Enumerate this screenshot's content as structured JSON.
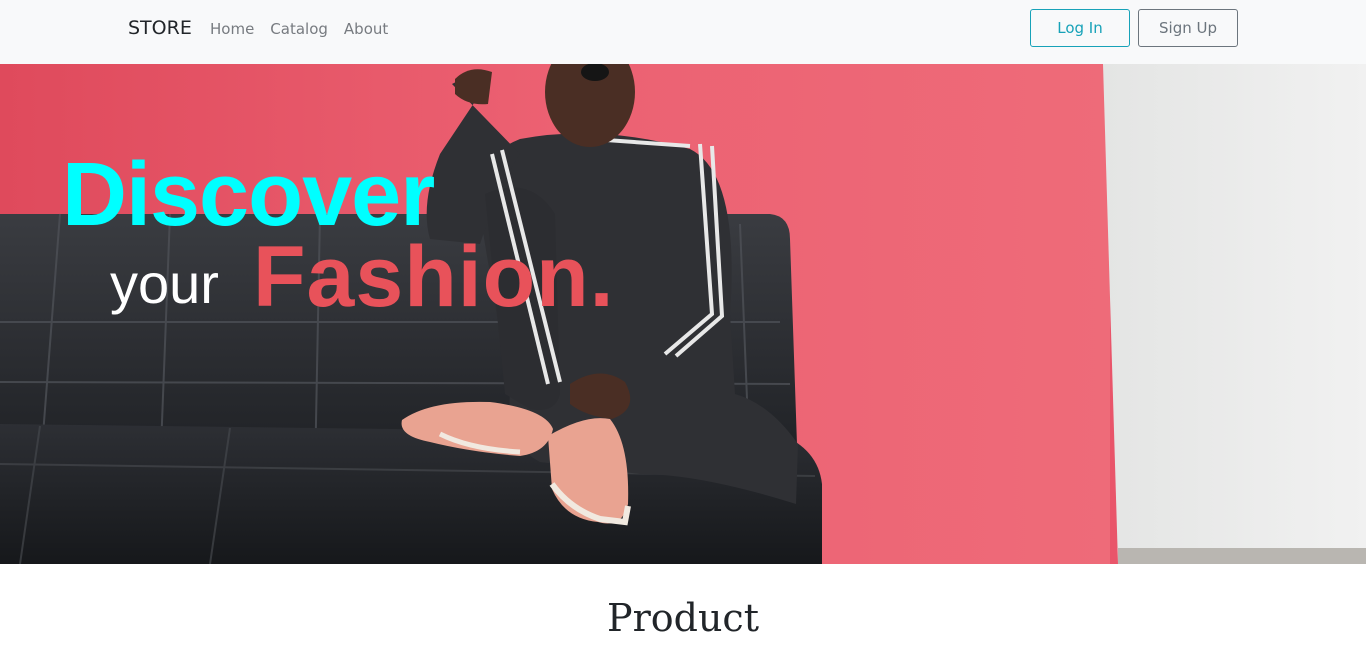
{
  "navbar": {
    "brand": "STORE",
    "links": [
      {
        "label": "Home"
      },
      {
        "label": "Catalog"
      },
      {
        "label": "About"
      }
    ],
    "login_label": "Log In",
    "signup_label": "Sign Up"
  },
  "hero": {
    "headline_1": "Discover",
    "headline_2": "your",
    "headline_3": "Fashion.",
    "image_semantic": "woman-on-black-sofa-photo"
  },
  "product": {
    "title": "Product"
  },
  "colors": {
    "cyan": "#00ffff",
    "coral": "#e8525a",
    "login_border": "#17a2b8",
    "signup_border": "#6c757d",
    "navbar_bg": "#f8f9fa"
  }
}
